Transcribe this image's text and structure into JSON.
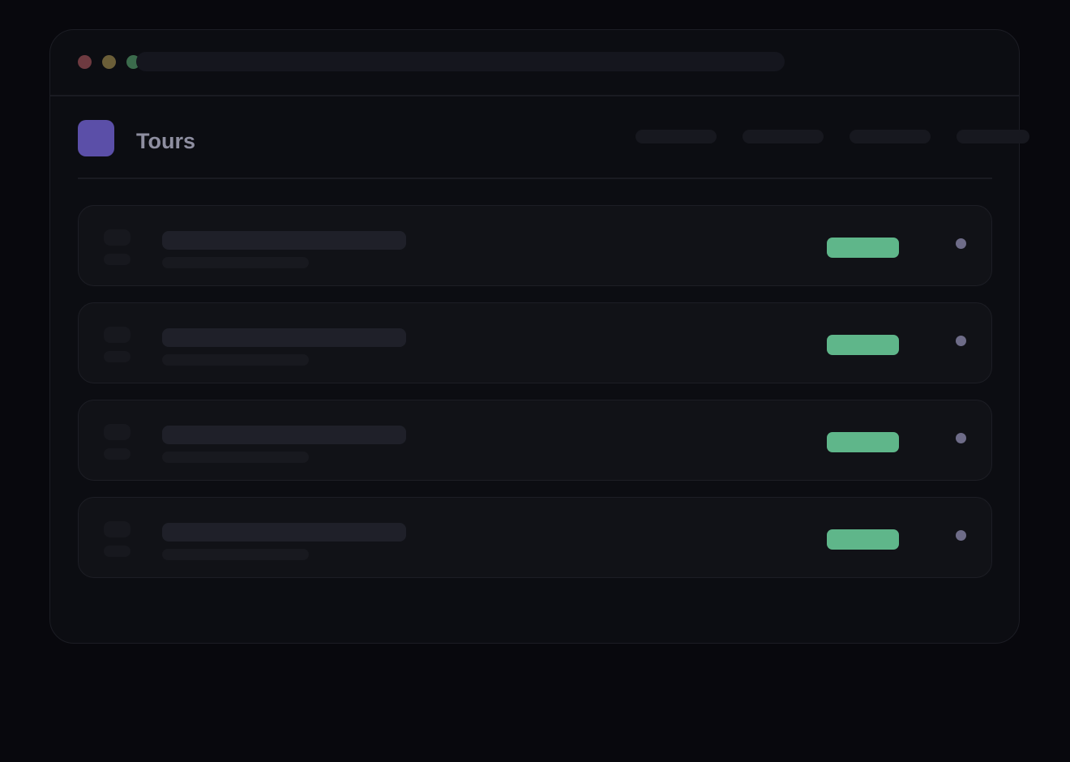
{
  "app": {
    "title": "Tours",
    "logo_color": "#5b4fa8"
  },
  "window_controls": {
    "close_color": "#6e3a40",
    "minimize_color": "#6b5e38",
    "maximize_color": "#3b6b4c"
  },
  "colors": {
    "background": "#08080d",
    "panel": "#0c0d12",
    "card": "#111217",
    "status": "#5fb68a",
    "menu_dot": "#6e6c88"
  },
  "nav": {
    "items": [
      "",
      "",
      "",
      ""
    ]
  },
  "tours": {
    "rows": [
      {
        "name": "",
        "detail": "",
        "status": ""
      },
      {
        "name": "",
        "detail": "",
        "status": ""
      },
      {
        "name": "",
        "detail": "",
        "status": ""
      },
      {
        "name": "",
        "detail": "",
        "status": ""
      }
    ]
  }
}
